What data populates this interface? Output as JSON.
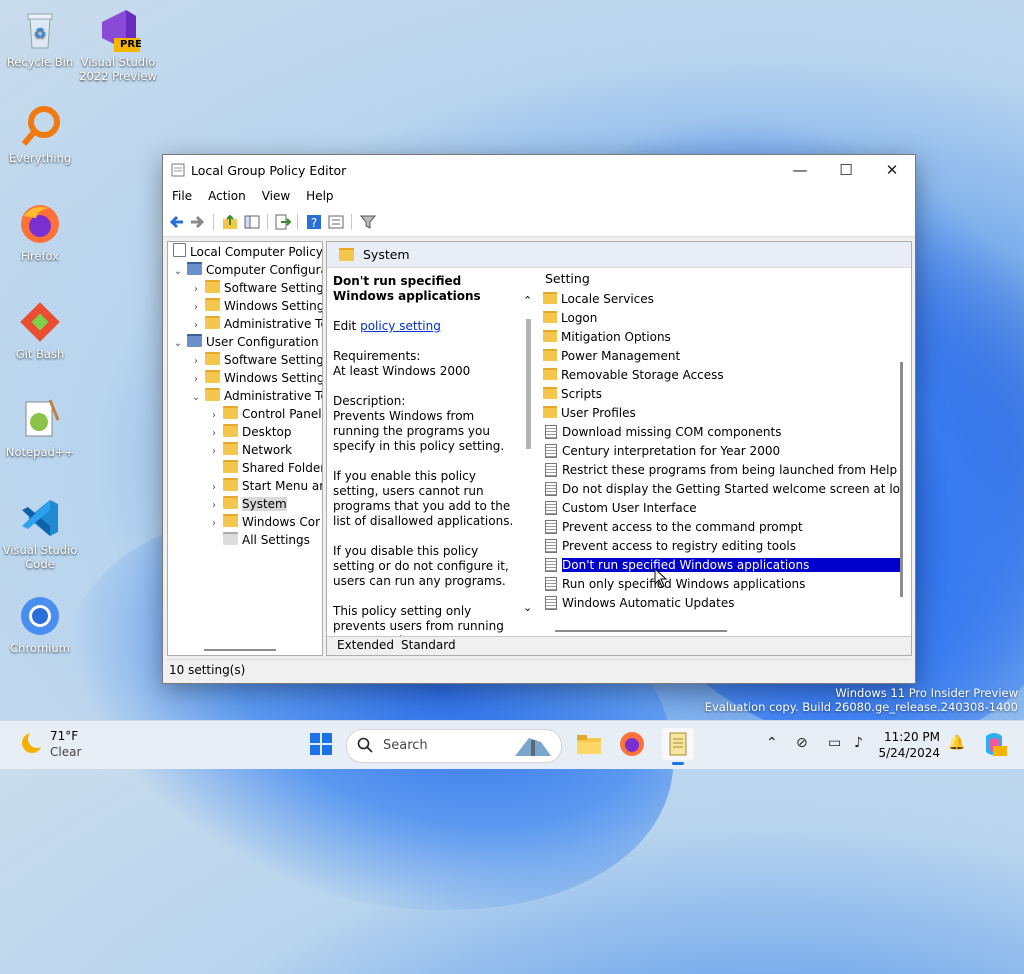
{
  "desktop": {
    "icons": [
      {
        "label": "Recycle Bin"
      },
      {
        "label": "Visual Studio 2022 Preview",
        "badge": "PRE"
      },
      {
        "label": "Everything"
      },
      {
        "label": "Firefox"
      },
      {
        "label": "Git Bash"
      },
      {
        "label": "Notepad++"
      },
      {
        "label": "Visual Studio Code"
      },
      {
        "label": "Chromium"
      }
    ],
    "watermark": {
      "line1": "Windows 11 Pro Insider Preview",
      "line2": "Evaluation copy. Build 26080.ge_release.240308-1400"
    }
  },
  "window": {
    "title": "Local Group Policy Editor",
    "controls": {
      "minimize": "—",
      "maximize": "☐",
      "close": "✕"
    },
    "menu": [
      "File",
      "Action",
      "View",
      "Help"
    ],
    "tree": [
      {
        "label": "Local Computer Policy"
      },
      {
        "label": "Computer Configura"
      },
      {
        "label": "Software Settings"
      },
      {
        "label": "Windows Setting"
      },
      {
        "label": "Administrative Te"
      },
      {
        "label": "User Configuration"
      },
      {
        "label": "Software Settings"
      },
      {
        "label": "Windows Setting"
      },
      {
        "label": "Administrative Te"
      },
      {
        "label": "Control Panel"
      },
      {
        "label": "Desktop"
      },
      {
        "label": "Network"
      },
      {
        "label": "Shared Folder"
      },
      {
        "label": "Start Menu ar"
      },
      {
        "label": "System"
      },
      {
        "label": "Windows Cor"
      },
      {
        "label": "All Settings"
      }
    ],
    "header": "System",
    "description": {
      "title": "Don't run specified Windows applications",
      "edit_prefix": "Edit",
      "edit_link": "policy setting",
      "requirements_label": "Requirements:",
      "requirements_value": "At least Windows 2000",
      "description_label": "Description:",
      "p1": "Prevents Windows from running the programs you specify in this policy setting.",
      "p2": "If you enable this policy setting, users cannot run programs that you add to the list of disallowed applications.",
      "p3": "If you disable this policy setting or do not configure it, users can run any programs.",
      "p4": "This policy setting only prevents users from running programs that"
    },
    "list_header": "Setting",
    "settings": [
      {
        "label": "Locale Services",
        "kind": "folder"
      },
      {
        "label": "Logon",
        "kind": "folder"
      },
      {
        "label": "Mitigation Options",
        "kind": "folder"
      },
      {
        "label": "Power Management",
        "kind": "folder"
      },
      {
        "label": "Removable Storage Access",
        "kind": "folder"
      },
      {
        "label": "Scripts",
        "kind": "folder"
      },
      {
        "label": "User Profiles",
        "kind": "folder"
      },
      {
        "label": "Download missing COM components",
        "kind": "policy"
      },
      {
        "label": "Century interpretation for Year 2000",
        "kind": "policy"
      },
      {
        "label": "Restrict these programs from being launched from Help",
        "kind": "policy"
      },
      {
        "label": "Do not display the Getting Started welcome screen at logon",
        "kind": "policy"
      },
      {
        "label": "Custom User Interface",
        "kind": "policy"
      },
      {
        "label": "Prevent access to the command prompt",
        "kind": "policy"
      },
      {
        "label": "Prevent access to registry editing tools",
        "kind": "policy"
      },
      {
        "label": "Don't run specified Windows applications",
        "kind": "policy",
        "selected": true
      },
      {
        "label": "Run only specified Windows applications",
        "kind": "policy"
      },
      {
        "label": "Windows Automatic Updates",
        "kind": "policy"
      }
    ],
    "tabs": {
      "extended": "Extended",
      "standard": "Standard"
    },
    "status": "10 setting(s)"
  },
  "taskbar": {
    "weather": {
      "temp": "71°F",
      "condition": "Clear"
    },
    "search_placeholder": "Search",
    "clock": {
      "time": "11:20 PM",
      "date": "5/24/2024"
    }
  },
  "colors": {
    "selection": "#0000cc",
    "accent": "#0067c0"
  }
}
